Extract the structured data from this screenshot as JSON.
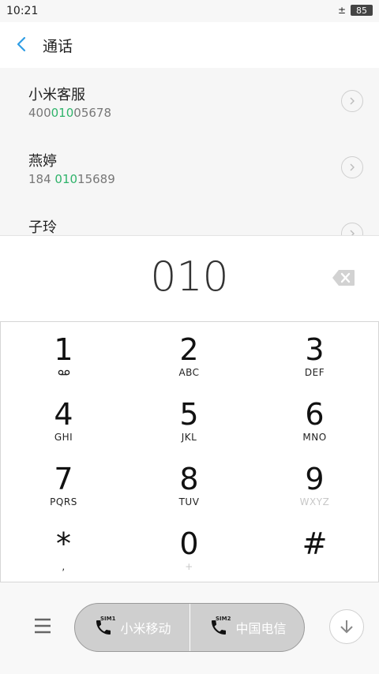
{
  "status_bar": {
    "time": "10:21",
    "network_icon": "±",
    "battery": "85"
  },
  "header": {
    "title": "通话"
  },
  "contacts": [
    {
      "name": "小米客服",
      "number_pre": "400",
      "number_match": "010",
      "number_post": "05678"
    },
    {
      "name": "燕婷",
      "number_pre": "184 ",
      "number_match": "010",
      "number_post": "15689"
    },
    {
      "name": "子玲",
      "number_pre": "",
      "number_match": "",
      "number_post": ""
    }
  ],
  "dialed_number": "010",
  "keypad": [
    {
      "digit": "1",
      "letters": ""
    },
    {
      "digit": "2",
      "letters": "ABC"
    },
    {
      "digit": "3",
      "letters": "DEF"
    },
    {
      "digit": "4",
      "letters": "GHI"
    },
    {
      "digit": "5",
      "letters": "JKL"
    },
    {
      "digit": "6",
      "letters": "MNO"
    },
    {
      "digit": "7",
      "letters": "PQRS"
    },
    {
      "digit": "8",
      "letters": "TUV"
    },
    {
      "digit": "9",
      "letters": "WXYZ"
    },
    {
      "digit": "*",
      "letters": ","
    },
    {
      "digit": "0",
      "letters": "+"
    },
    {
      "digit": "#",
      "letters": ""
    }
  ],
  "call_buttons": [
    {
      "label": "小米移动",
      "sim": "SIM1"
    },
    {
      "label": "中国电信",
      "sim": "SIM2"
    }
  ],
  "colors": {
    "accent": "#2f9de4",
    "match": "#2fb36a",
    "call_button": "#cfcfcf"
  }
}
